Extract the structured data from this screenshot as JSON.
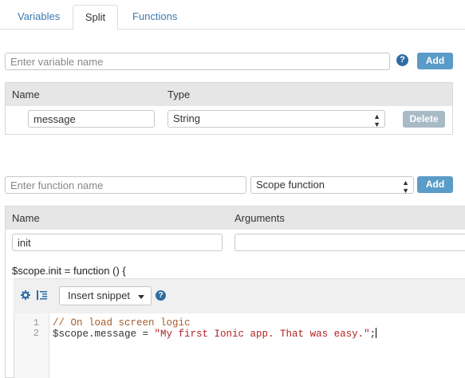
{
  "tabs": [
    {
      "label": "Variables"
    },
    {
      "label": "Split"
    },
    {
      "label": "Functions"
    }
  ],
  "variables": {
    "name_placeholder": "Enter variable name",
    "help_label": "?",
    "add_label": "Add",
    "table": {
      "col_name": "Name",
      "col_type": "Type",
      "row": {
        "name": "message",
        "type": "String",
        "delete_label": "Delete"
      }
    }
  },
  "functions": {
    "name_placeholder": "Enter function name",
    "scope_select": "Scope function",
    "add_label": "Add",
    "table": {
      "col_name": "Name",
      "col_arguments": "Arguments",
      "row": {
        "name": "init",
        "arguments": ""
      }
    },
    "signature": "$scope.init = function () {",
    "toolbar": {
      "settings_icon": "gear-icon",
      "indent_icon": "indent-icon",
      "snippet_label": "Insert snippet",
      "help_label": "?"
    },
    "editor": {
      "line_numbers": [
        "1",
        "2"
      ],
      "line1": "// On load screen logic",
      "line2_pre": "$scope.message = ",
      "line2_str": "\"My first Ionic app. That was easy.\"",
      "line2_post": ";"
    }
  },
  "colors": {
    "accent": "#5b9bc8",
    "link": "#3a7ab0",
    "delete_button": "#a9bac7",
    "header_bg": "#e6e6e6"
  }
}
